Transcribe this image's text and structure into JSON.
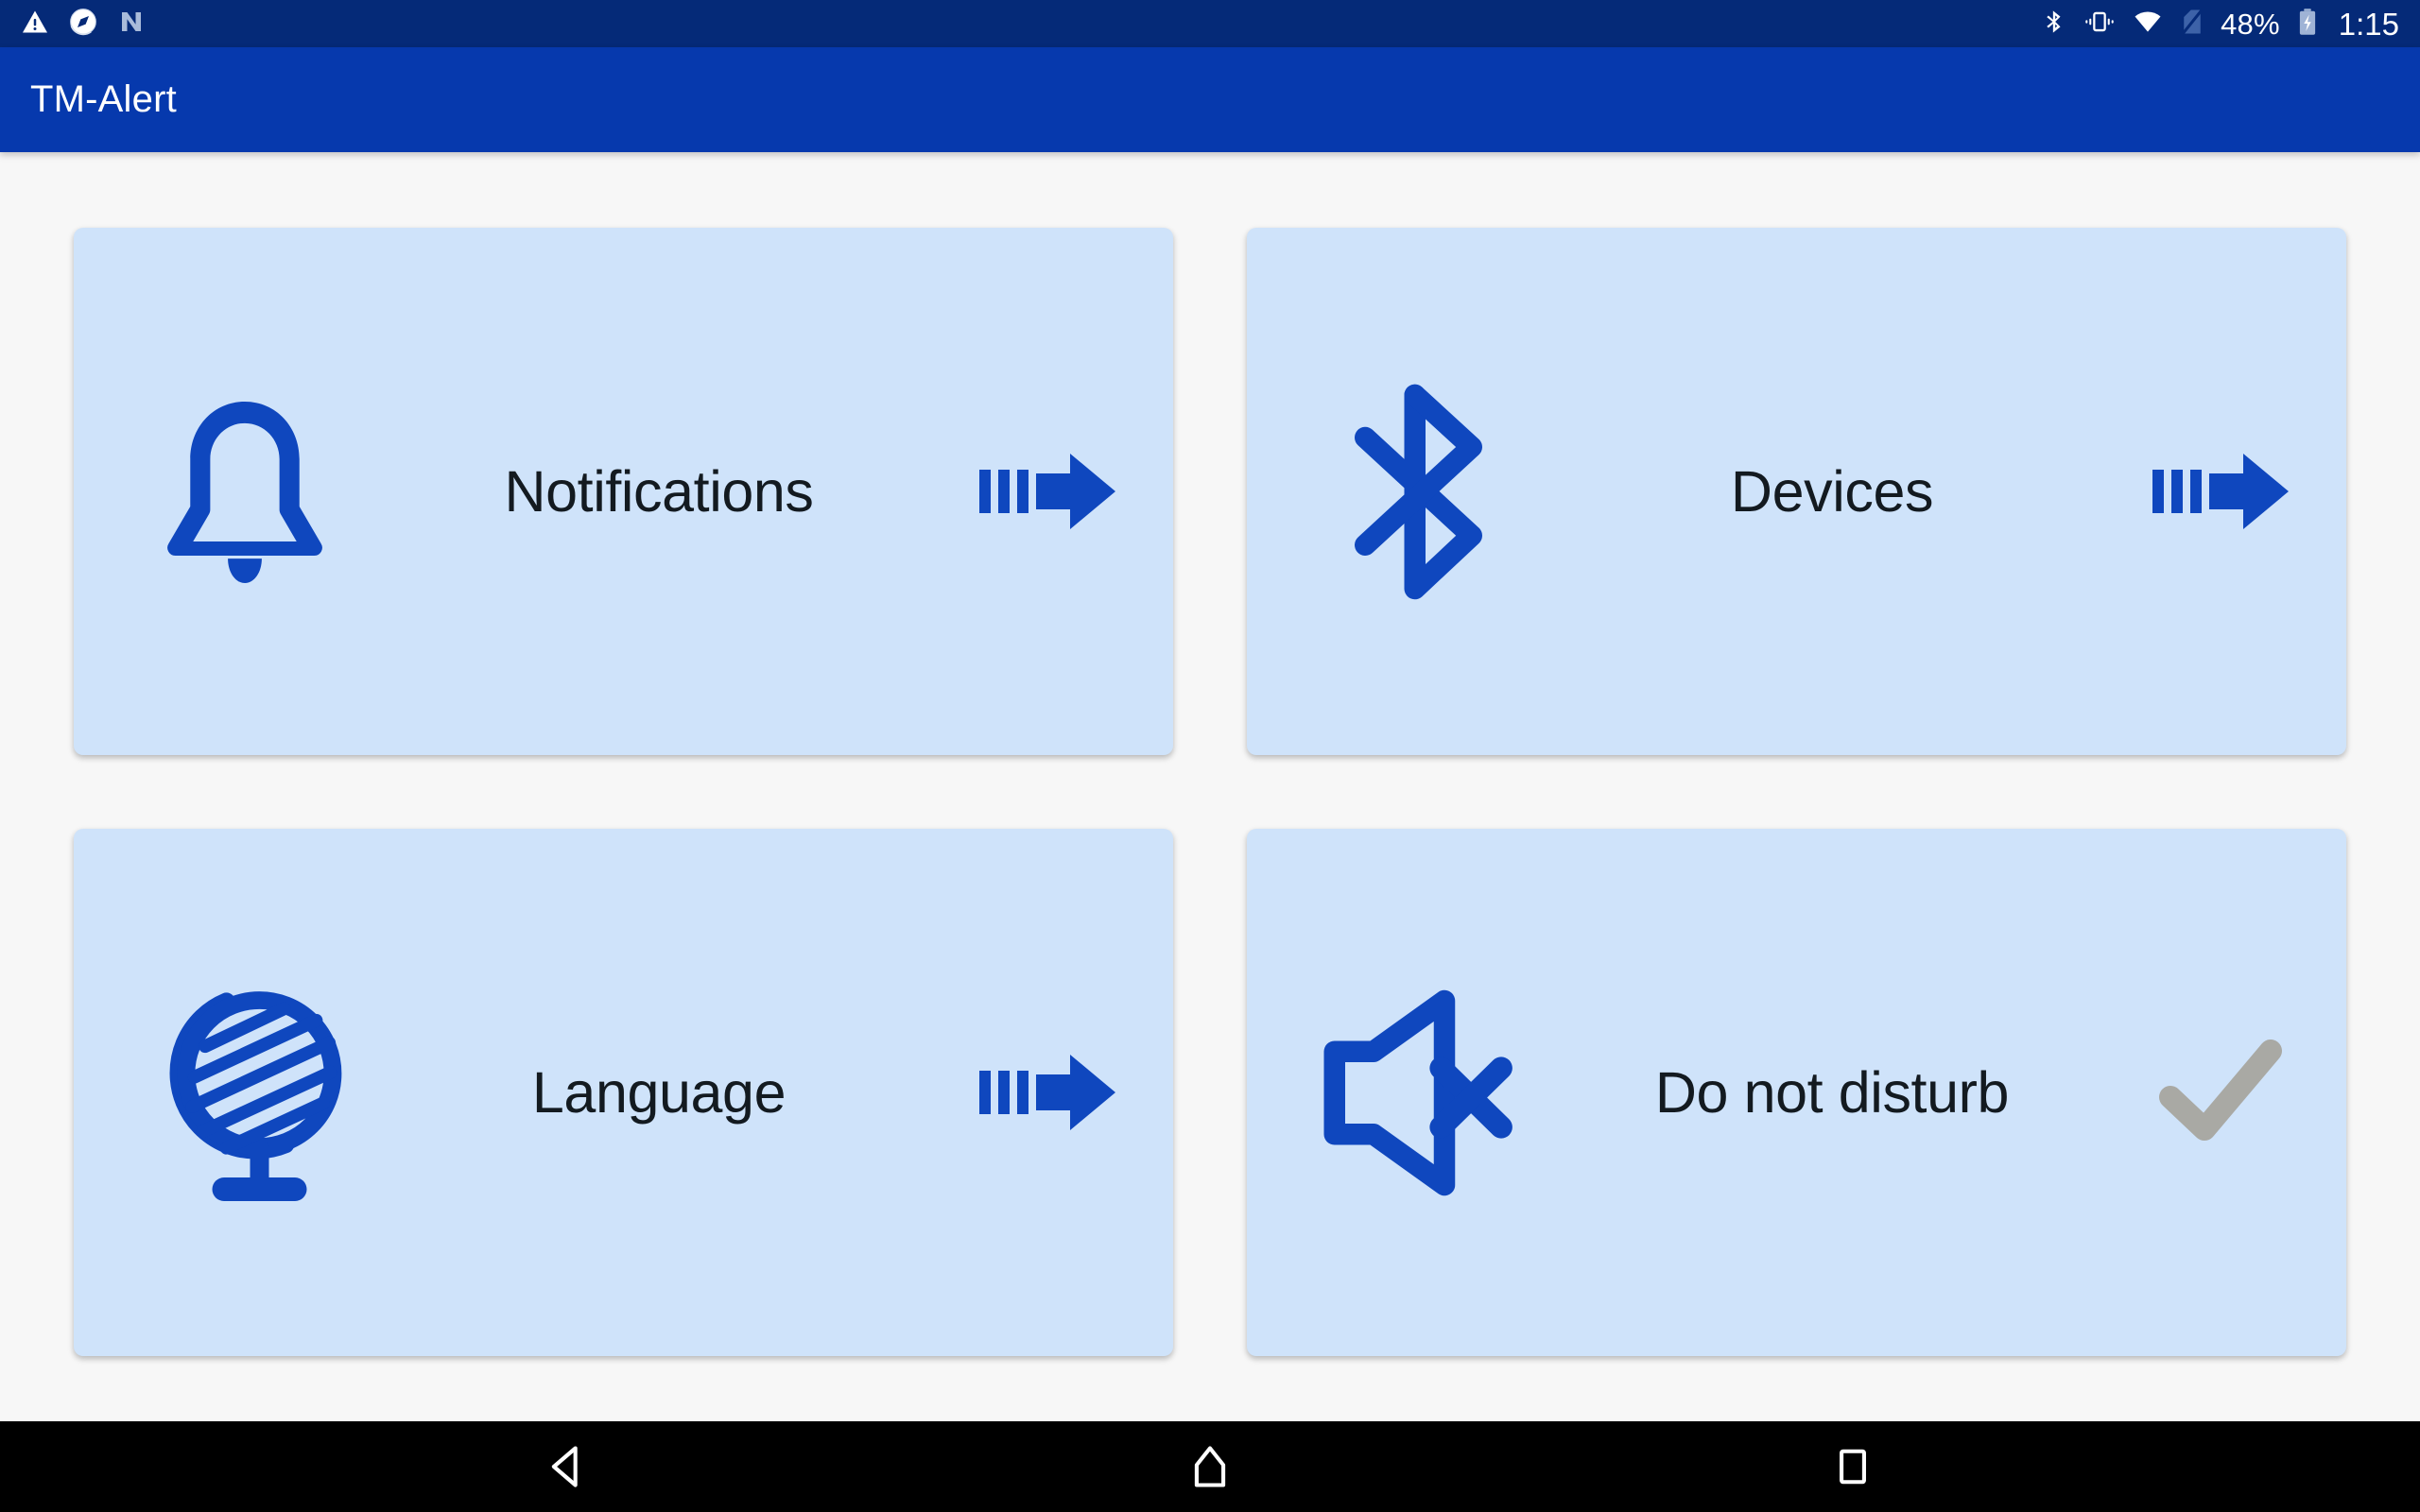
{
  "status_bar": {
    "background_color": "#052A78",
    "left_icons": [
      {
        "name": "warning-triangle-icon",
        "glyph": "warning"
      },
      {
        "name": "compass-globe-icon",
        "glyph": "compass"
      },
      {
        "name": "android-n-icon",
        "glyph": "android-n"
      }
    ],
    "right_icons": [
      {
        "name": "bluetooth-icon",
        "glyph": "bluetooth"
      },
      {
        "name": "vibrate-icon",
        "glyph": "vibrate"
      },
      {
        "name": "wifi-icon",
        "glyph": "wifi"
      },
      {
        "name": "no-sim-icon",
        "glyph": "no-sim"
      }
    ],
    "battery_percent": "48%",
    "battery_state": "charging",
    "clock": "1:15"
  },
  "app_bar": {
    "title": "TM-Alert",
    "background_color": "#0639AD",
    "text_color": "#FFFFFF"
  },
  "theme": {
    "page_background": "#F7F7F7",
    "card_background": "#CFE3FA",
    "accent_blue": "#0F47BE",
    "label_color": "#131A20",
    "check_gray": "#A9A9A4"
  },
  "main": {
    "cards": [
      {
        "id": "notifications",
        "label": "Notifications",
        "icon": "bell-icon",
        "action": "motion-arrow-right-icon",
        "action_type": "arrow",
        "enabled": true
      },
      {
        "id": "devices",
        "label": "Devices",
        "icon": "bluetooth-icon",
        "action": "motion-arrow-right-icon",
        "action_type": "arrow",
        "enabled": true
      },
      {
        "id": "language",
        "label": "Language",
        "icon": "globe-icon",
        "action": "motion-arrow-right-icon",
        "action_type": "arrow",
        "enabled": true
      },
      {
        "id": "do-not-disturb",
        "label": "Do not disturb",
        "icon": "speaker-mute-icon",
        "action": "checkmark-icon",
        "action_type": "check",
        "enabled": true
      }
    ]
  },
  "nav_bar": {
    "background_color": "#000000",
    "buttons": [
      {
        "name": "nav-back-button",
        "glyph": "back-triangle"
      },
      {
        "name": "nav-home-button",
        "glyph": "home-pentagon"
      },
      {
        "name": "nav-recents-button",
        "glyph": "recents-square"
      }
    ]
  }
}
